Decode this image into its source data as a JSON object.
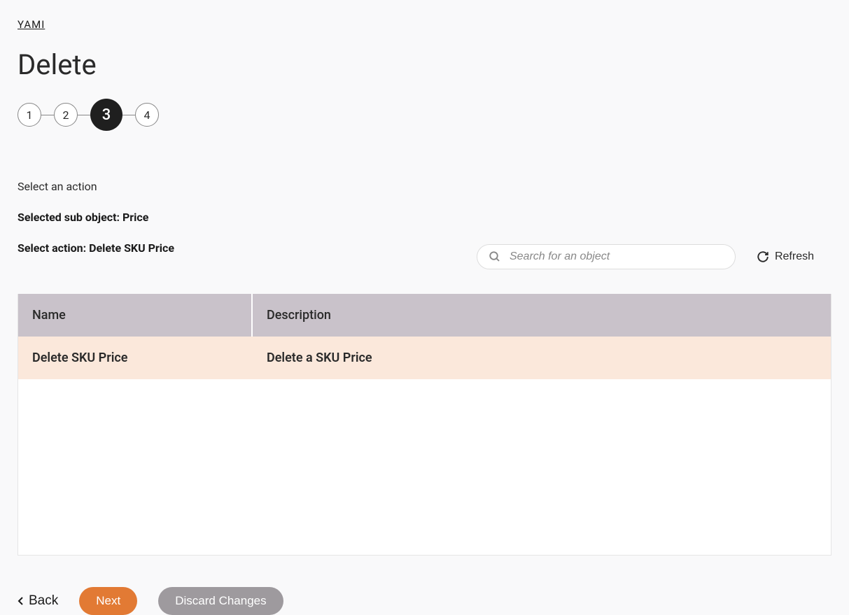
{
  "breadcrumb": "YAMI",
  "page_title": "Delete",
  "stepper": {
    "steps": [
      "1",
      "2",
      "3",
      "4"
    ],
    "active_index": 2
  },
  "instruction": "Select an action",
  "selected_sub_object_label": "Selected sub object: Price",
  "select_action_label": "Select action: Delete SKU Price",
  "search": {
    "placeholder": "Search for an object",
    "value": ""
  },
  "refresh_label": "Refresh",
  "table": {
    "headers": {
      "name": "Name",
      "description": "Description"
    },
    "rows": [
      {
        "name": "Delete SKU Price",
        "description": "Delete a SKU Price"
      }
    ]
  },
  "buttons": {
    "back": "Back",
    "next": "Next",
    "discard": "Discard Changes"
  }
}
